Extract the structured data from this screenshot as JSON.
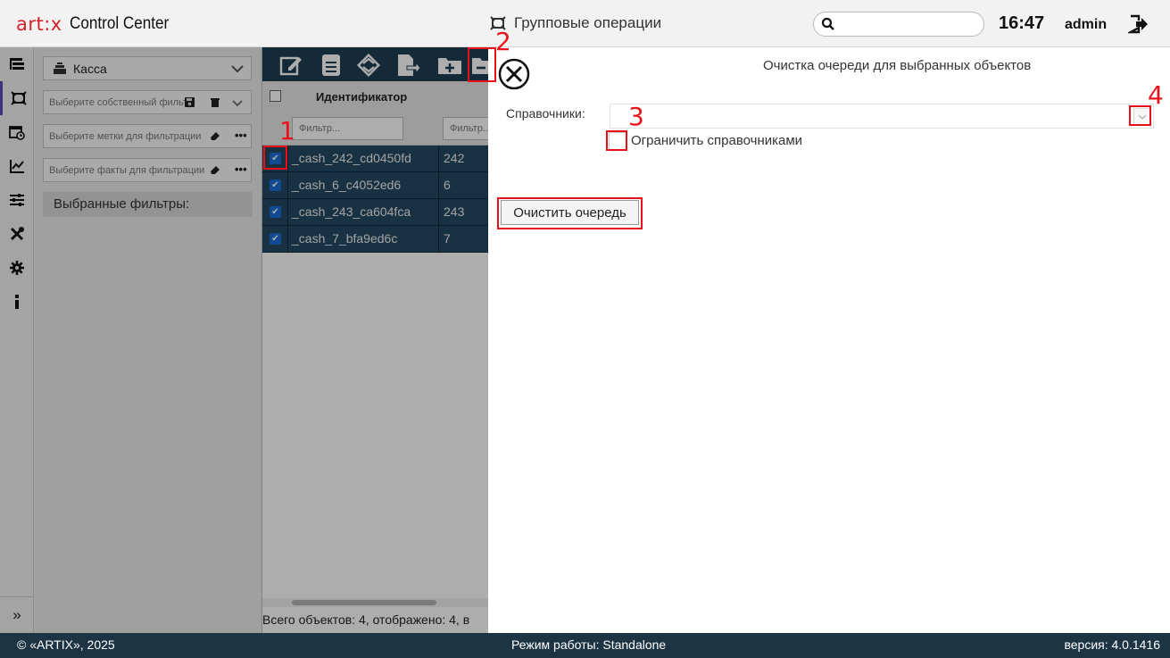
{
  "header": {
    "logo_text": "art:x",
    "app_name": "Control Center",
    "page_title": "Групповые операции",
    "search_placeholder": "",
    "clock": "16:47",
    "user": "admin"
  },
  "rail": {
    "items": [
      "tree-icon",
      "group-operations-icon",
      "schedule-icon",
      "chart-icon",
      "sliders-icon",
      "tools-icon",
      "gear-icon",
      "info-icon"
    ],
    "active": "group-operations-icon",
    "expand_glyph": "»"
  },
  "filters": {
    "object_type": "Касса",
    "own_filter_placeholder": "Выберите собственный фильтр",
    "tags_placeholder": "Выберите метки для фильтрации",
    "facts_placeholder": "Выберите факты для фильтрации",
    "selected_filters_title": "Выбранные фильтры:"
  },
  "grid": {
    "column_id": "Идентификатор",
    "filter_placeholder": "Фильтр...",
    "filter_placeholder_2": "Фильтр...",
    "rows": [
      {
        "id": "_cash_242_cd0450fd",
        "code": "242",
        "checked": true
      },
      {
        "id": "_cash_6_c4052ed6",
        "code": "6",
        "checked": true
      },
      {
        "id": "_cash_243_ca604fca",
        "code": "243",
        "checked": true
      },
      {
        "id": "_cash_7_bfa9ed6c",
        "code": "7",
        "checked": true
      }
    ],
    "status": "Всего объектов: 4, отображено: 4, в"
  },
  "dialog": {
    "title": "Очистка очереди для выбранных объектов",
    "field_label": "Справочники:",
    "limit_label": "Ограничить справочниками",
    "limit_checked": false,
    "clear_button": "Очистить очередь"
  },
  "annotations": [
    "1",
    "2",
    "3",
    "4"
  ],
  "footer": {
    "copyright": "© «ARTIX», 2025",
    "mode": "Режим работы: Standalone",
    "version": "версия: 4.0.1416"
  },
  "colors": {
    "brand_red": "#d4202a",
    "grid_toolbar": "#1e3f55",
    "row_selected": "#244a63",
    "footer": "#1c3444",
    "annotation": "#e8111a"
  }
}
